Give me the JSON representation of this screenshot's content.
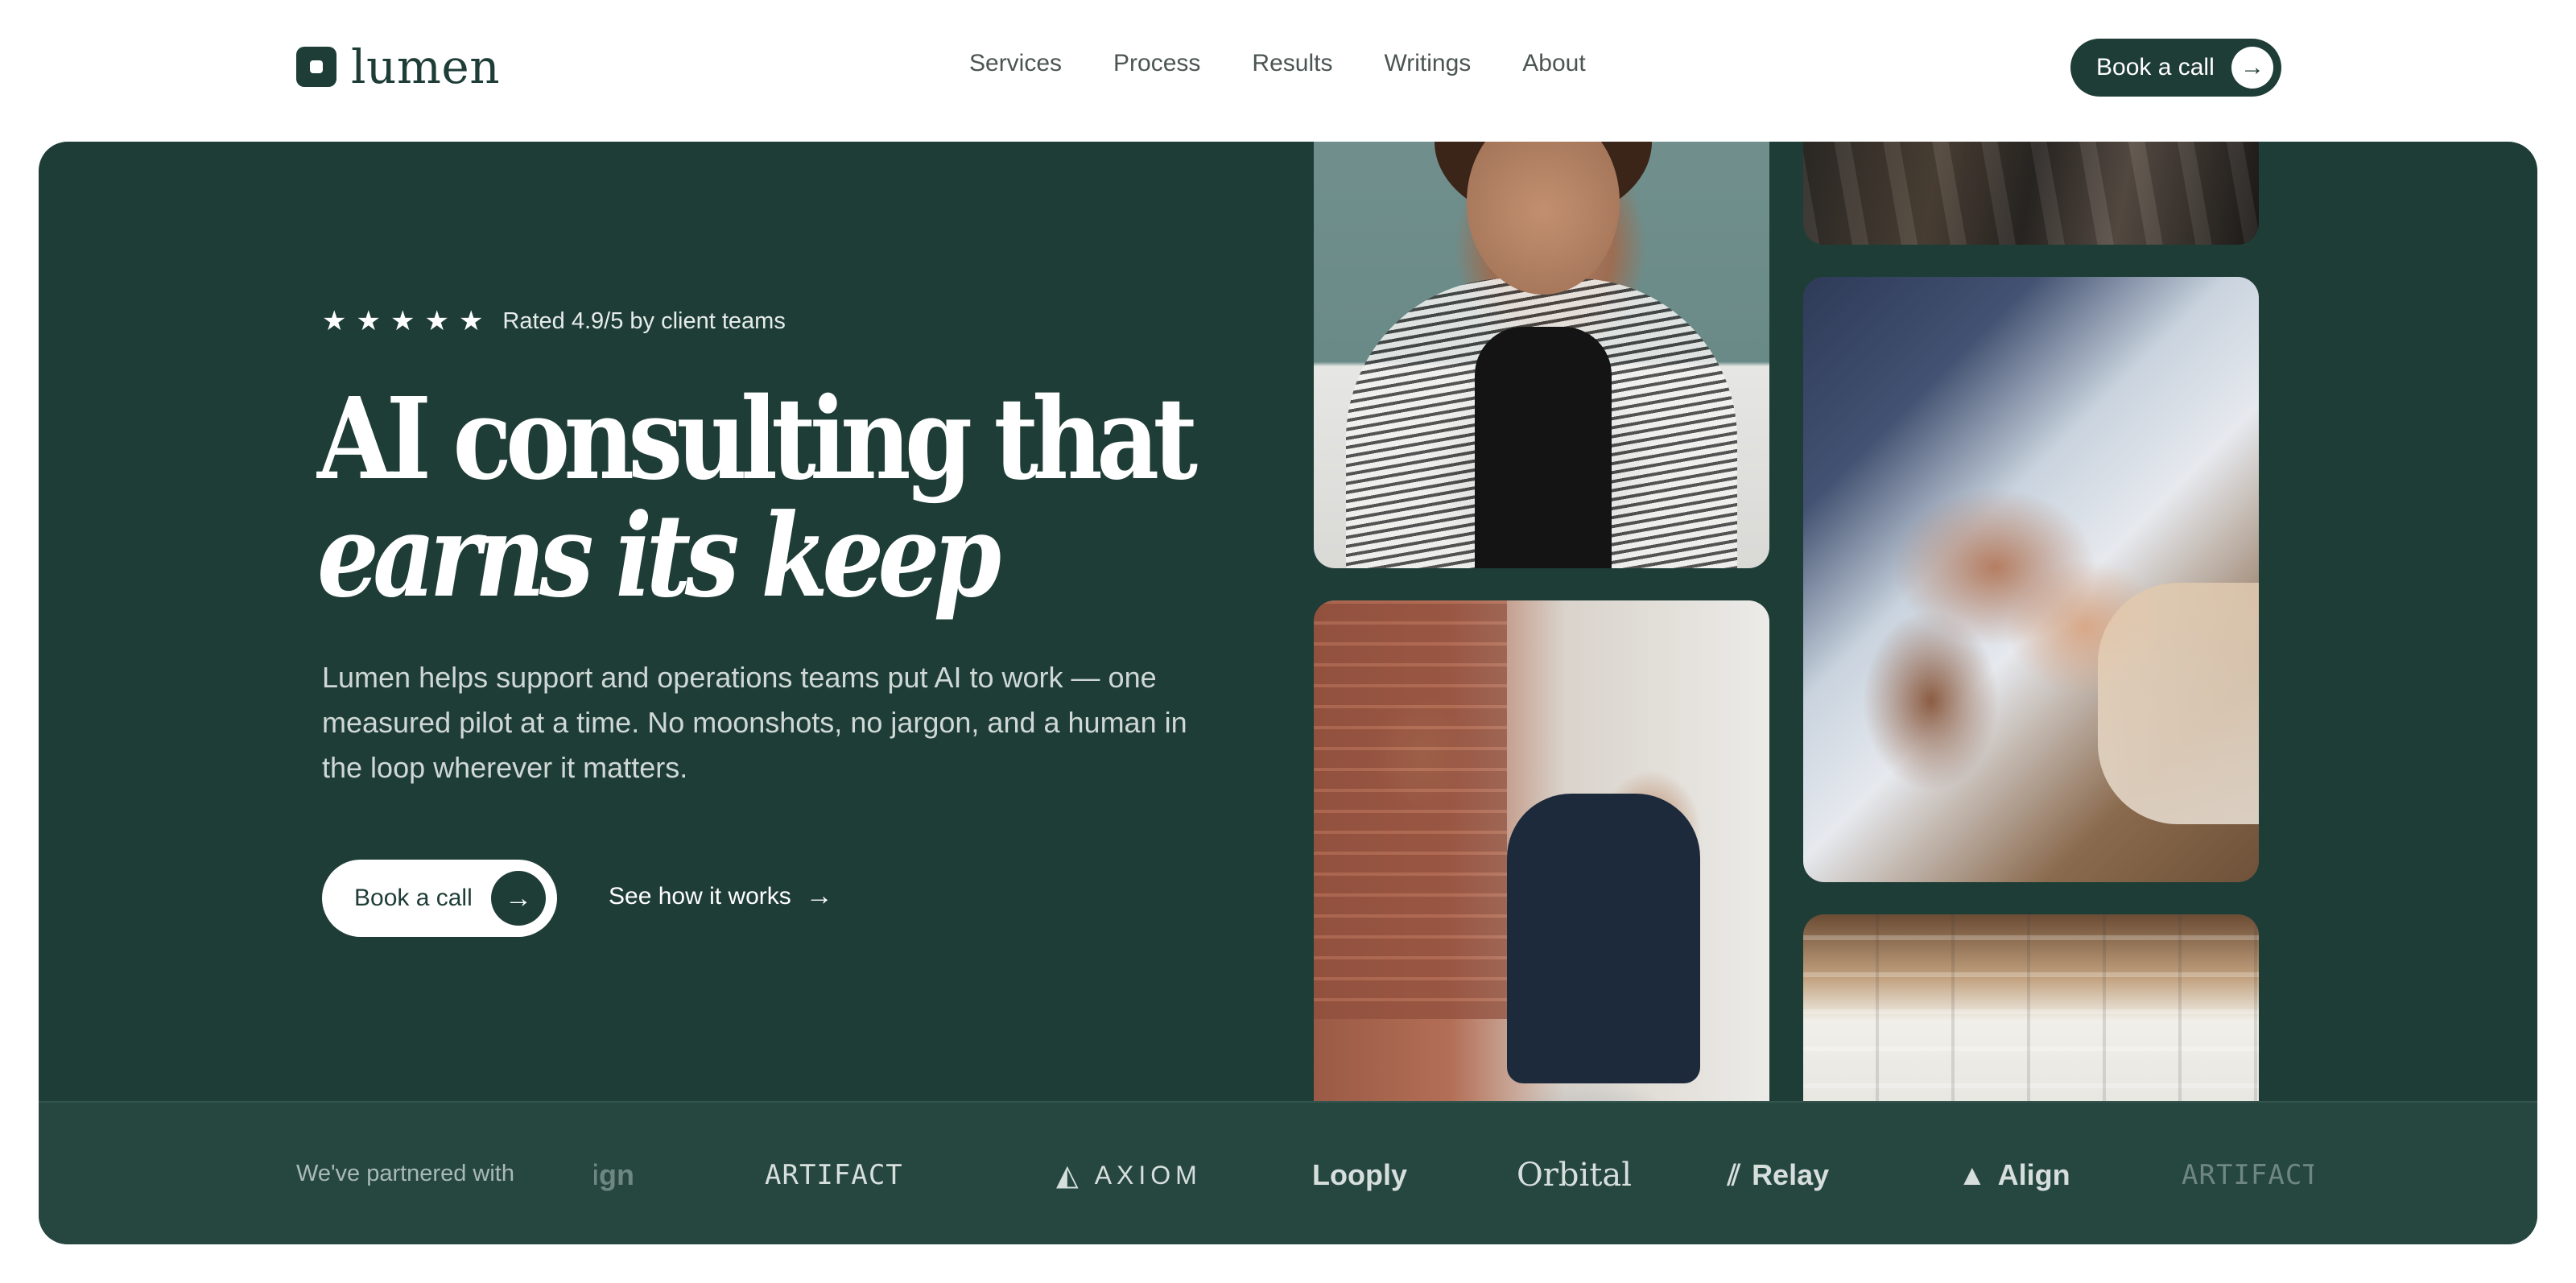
{
  "brand": {
    "name": "lumen"
  },
  "nav": {
    "links": [
      "Services",
      "Process",
      "Results",
      "Writings",
      "About"
    ],
    "cta_label": "Book a call",
    "cta_icon": "arrow-right-icon"
  },
  "hero": {
    "rating": {
      "stars": 5,
      "text": "Rated 4.9/5 by client teams"
    },
    "headline_line1": "AI consulting that",
    "headline_line2": "earns its keep",
    "subtext": "Lumen helps support and operations teams put AI to work — one measured pilot at a time. No moonshots, no jargon, and a human in the loop wherever it matters.",
    "primary_button": "Book a call",
    "secondary_link": "See how it works"
  },
  "partners": {
    "label": "We've partnered with",
    "logos": [
      "Align",
      "ARTIFACT",
      "AXIOM",
      "Looply",
      "Orbital",
      "Relay",
      "Align",
      "ARTIFACT"
    ]
  },
  "colors": {
    "brand_green": "#1f3d37",
    "partners_bg": "#264740",
    "white": "#ffffff"
  }
}
